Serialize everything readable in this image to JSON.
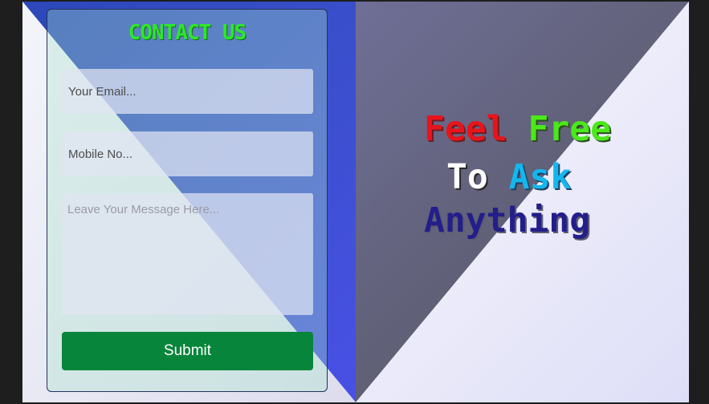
{
  "contact": {
    "title": "CONTACT US",
    "email_placeholder": "Your Email...",
    "mobile_placeholder": "Mobile No...",
    "message_placeholder": "Leave Your Message Here...",
    "submit_label": "Submit"
  },
  "tagline": {
    "word_feel": "Feel",
    "word_free": "Free",
    "word_to": "To",
    "word_ask": "Ask",
    "word_anything": "Anything"
  },
  "colors": {
    "title_green": "#2ee62a",
    "submit_green": "#07853a",
    "blue_panel": "#3a4fcc",
    "gray_panel": "#5f5f75",
    "feel": "#e8141b",
    "free": "#4be81a",
    "to": "#ffffff",
    "ask": "#13b7ee",
    "anything": "#231e8a"
  }
}
